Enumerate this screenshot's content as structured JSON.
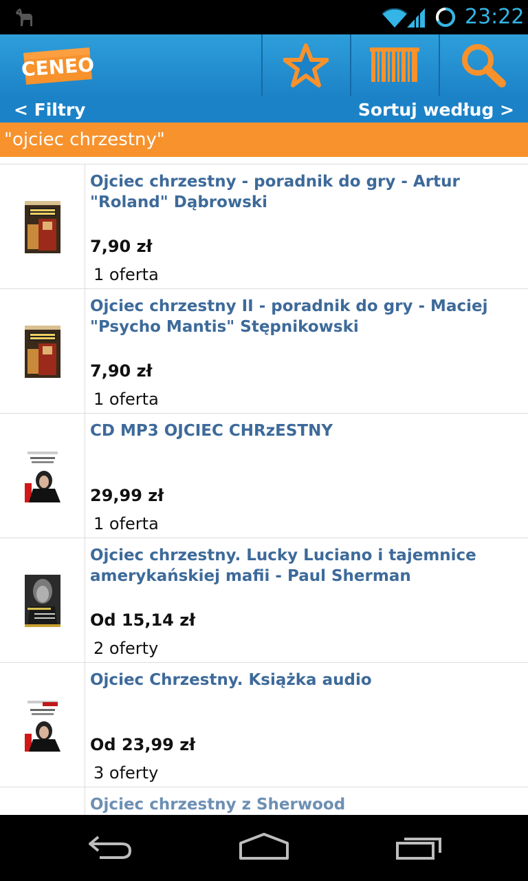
{
  "status_bar": {
    "time": "23:22",
    "notification_icon": "llama-icon",
    "wifi_icon": "wifi-icon",
    "signal_icon": "cell-signal-icon",
    "battery_icon": "battery-circle-icon"
  },
  "action_bar": {
    "logo_text": "CENEO",
    "favorites_icon": "star-icon",
    "barcode_icon": "barcode-icon",
    "search_icon": "search-icon",
    "colors": {
      "bar": "#2391d3",
      "accent": "#f7922d"
    }
  },
  "filter_bar": {
    "filters_label": "< Filtry",
    "sort_label": "Sortuj według >"
  },
  "query": {
    "text": "\"ojciec chrzestny\""
  },
  "products": [
    {
      "title": "Ojciec chrzestny - poradnik do gry - Artur \"Roland\" Dąbrowski",
      "price": "7,90 zł",
      "offers": "1 oferta",
      "cover": "game-guide-cover"
    },
    {
      "title": "Ojciec chrzestny II - poradnik do gry - Maciej \"Psycho Mantis\" Stępnikowski",
      "price": "7,90 zł",
      "offers": "1 oferta",
      "cover": "game-guide-cover"
    },
    {
      "title": "CD MP3 OJCIEC CHRzESTNY",
      "price": "29,99 zł",
      "offers": "1 oferta",
      "cover": "audiobook-cover"
    },
    {
      "title": "Ojciec chrzestny. Lucky Luciano i tajemnice amerykańskiej mafii - Paul Sherman",
      "price": "Od 15,14 zł",
      "offers": "2 oferty",
      "cover": "book-cover"
    },
    {
      "title": "Ojciec Chrzestny. Książka audio",
      "price": "Od 23,99 zł",
      "offers": "3 oferty",
      "cover": "audiobook-cover"
    },
    {
      "title": "Ojciec chrzestny z Sherwood",
      "price": "",
      "offers": "",
      "cover": ""
    }
  ],
  "nav_bar": {
    "back_icon": "back-icon",
    "home_icon": "home-icon",
    "recent_icon": "recent-apps-icon"
  }
}
